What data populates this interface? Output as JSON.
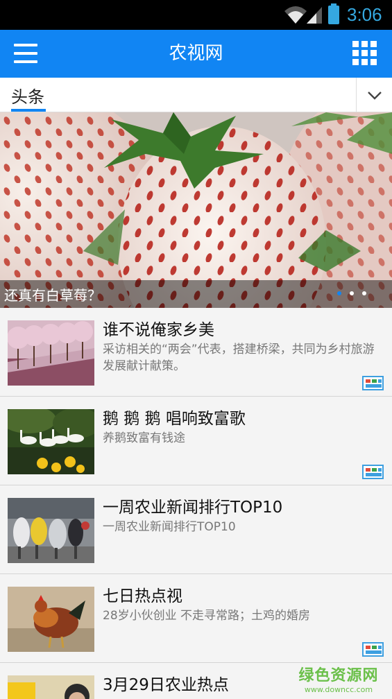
{
  "status_bar": {
    "time": "3:06"
  },
  "app_bar": {
    "title": "农视网"
  },
  "category_tabs": {
    "active_tab": "头条"
  },
  "banner": {
    "caption": "还真有白草莓？",
    "slide_count": 3,
    "active_slide": 1
  },
  "news": [
    {
      "title": "谁不说俺家乡美",
      "desc": "采访相关的“两会”代表，搭建桥梁，共同为乡村旅游发展献计献策。",
      "has_video_badge": true
    },
    {
      "title": "鹅 鹅 鹅 唱响致富歌",
      "desc": "养鹅致富有钱途",
      "has_video_badge": true
    },
    {
      "title": "一周农业新闻排行TOP10",
      "desc": "一周农业新闻排行TOP10",
      "has_video_badge": false
    },
    {
      "title": "七日热点视",
      "desc": "28岁小伙创业 不走寻常路；土鸡的婚房",
      "has_video_badge": true
    },
    {
      "title": "3月29日农业热点",
      "desc": "",
      "has_video_badge": false
    }
  ],
  "watermark": {
    "name": "绿色资源网",
    "url": "www.downcc.com"
  },
  "colors": {
    "accent": "#1185f3",
    "status_icon": "#35a8e0",
    "watermark": "#6bc04a"
  }
}
